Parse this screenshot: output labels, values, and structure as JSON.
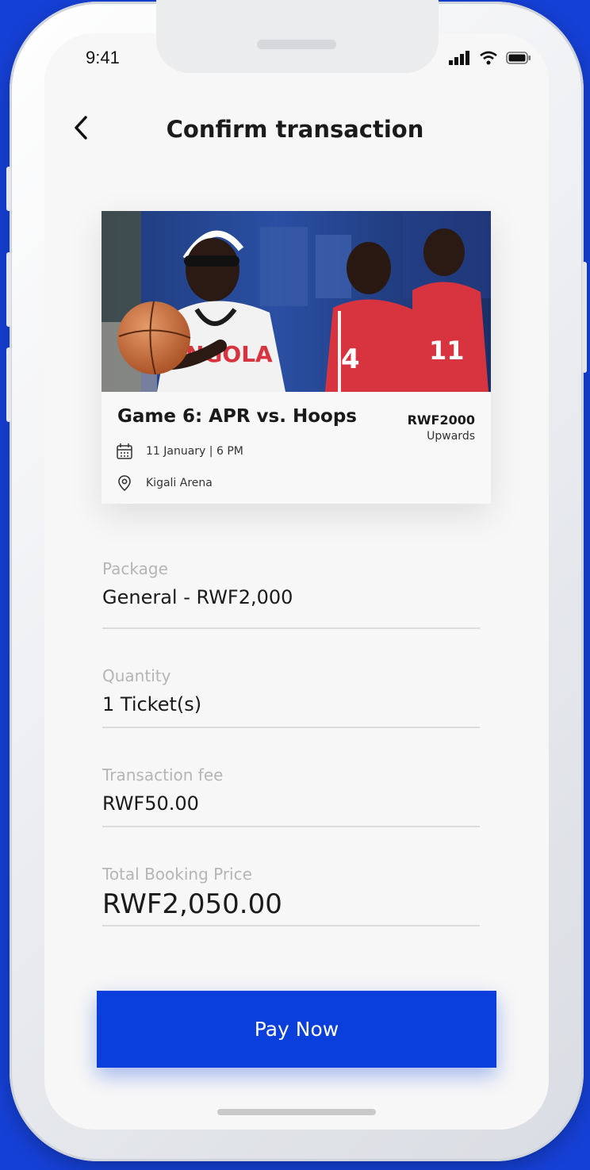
{
  "status_bar": {
    "time": "9:41"
  },
  "header": {
    "title": "Confirm transaction"
  },
  "event": {
    "title": "Game 6: APR vs. Hoops",
    "price": "RWF2000",
    "price_note": "Upwards",
    "date": "11 January | 6 PM",
    "venue": "Kigali Arena",
    "image": {
      "jersey_text": "NGOLA",
      "player_numbers": [
        "4",
        "11"
      ]
    }
  },
  "form": {
    "package": {
      "label": "Package",
      "value": "General - RWF2,000"
    },
    "quantity": {
      "label": "Quantity",
      "value": "1 Ticket(s)"
    },
    "fee": {
      "label": "Transaction fee",
      "value": "RWF50.00"
    },
    "total": {
      "label": "Total Booking Price",
      "value": "RWF2,050.00"
    }
  },
  "actions": {
    "pay_label": "Pay Now"
  },
  "colors": {
    "accent": "#0a3fdb",
    "background": "#1540d6",
    "jersey_red": "#d8343f"
  },
  "icons": [
    "back-arrow-icon",
    "signal-icon",
    "wifi-icon",
    "battery-icon",
    "calendar-icon",
    "location-pin-icon"
  ]
}
